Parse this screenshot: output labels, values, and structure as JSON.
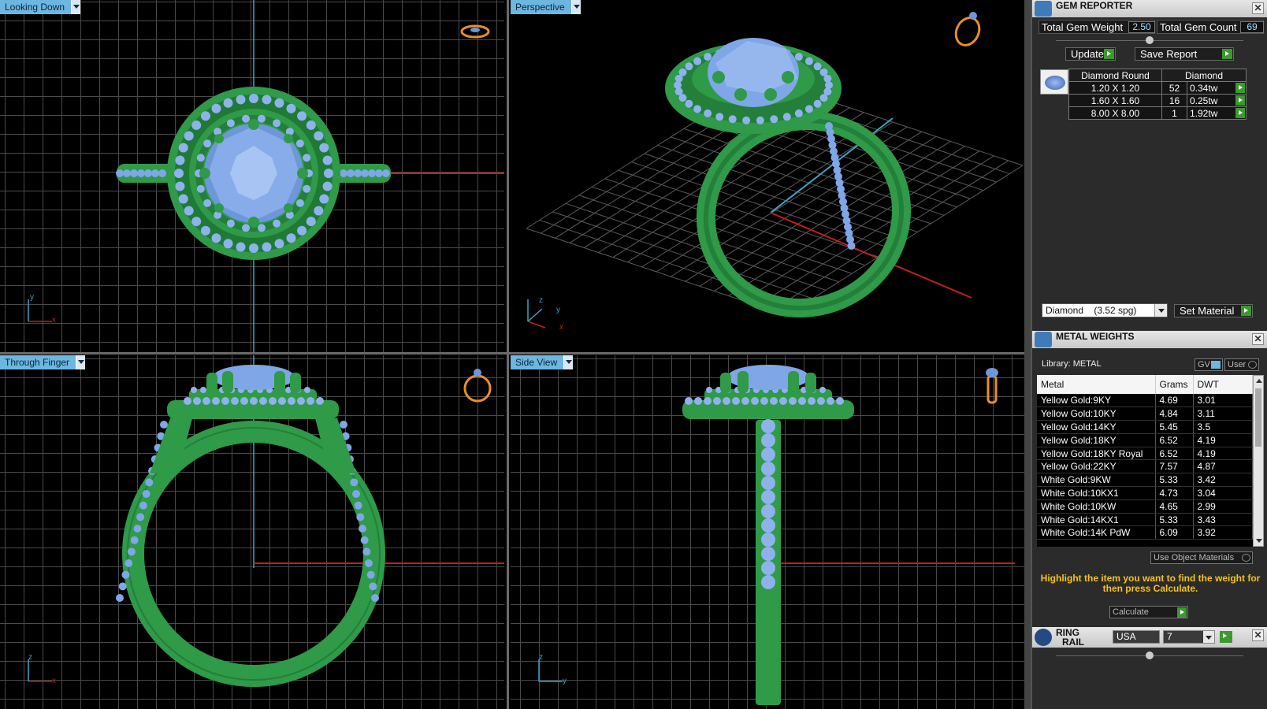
{
  "viewports": [
    {
      "id": "top",
      "label": "Looking Down"
    },
    {
      "id": "persp",
      "label": "Perspective"
    },
    {
      "id": "front",
      "label": "Through Finger"
    },
    {
      "id": "side",
      "label": "Side View"
    }
  ],
  "axes": {
    "top": {
      "a": "y",
      "b": "x"
    },
    "persp": {
      "a": "z",
      "b": "y",
      "c": "x"
    },
    "front": {
      "a": "z",
      "b": "x"
    },
    "side": {
      "a": "z",
      "b": "y"
    }
  },
  "gem_reporter": {
    "title": "GEM REPORTER",
    "total_weight_label": "Total Gem Weight",
    "total_weight_value": "2.50",
    "total_count_label": "Total Gem Count",
    "total_count_value": "69",
    "update_label": "Update",
    "save_label": "Save Report",
    "col_shape": "Diamond Round",
    "col_material": "Diamond",
    "rows": [
      {
        "size": "1.20 X 1.20",
        "count": "52",
        "weight": "0.34tw"
      },
      {
        "size": "1.60 X 1.60",
        "count": "16",
        "weight": "0.25tw"
      },
      {
        "size": "8.00 X 8.00",
        "count": "1",
        "weight": "1.92tw"
      }
    ],
    "material_select": "Diamond    (3.52 spg)",
    "set_material_label": "Set Material"
  },
  "metal_weights": {
    "title": "METAL WEIGHTS",
    "library": "Library: METAL",
    "gv": "GV",
    "user": "User",
    "col_metal": "Metal",
    "col_grams": "Grams",
    "col_dwt": "DWT",
    "rows": [
      {
        "metal": "Yellow Gold:9KY",
        "grams": "4.69",
        "dwt": "3.01"
      },
      {
        "metal": "Yellow Gold:10KY",
        "grams": "4.84",
        "dwt": "3.11"
      },
      {
        "metal": "Yellow Gold:14KY",
        "grams": "5.45",
        "dwt": "3.5"
      },
      {
        "metal": "Yellow Gold:18KY",
        "grams": "6.52",
        "dwt": "4.19"
      },
      {
        "metal": "Yellow Gold:18KY Royal",
        "grams": "6.52",
        "dwt": "4.19"
      },
      {
        "metal": "Yellow Gold:22KY",
        "grams": "7.57",
        "dwt": "4.87"
      },
      {
        "metal": "White Gold:9KW",
        "grams": "5.33",
        "dwt": "3.42"
      },
      {
        "metal": "White Gold:10KX1",
        "grams": "4.73",
        "dwt": "3.04"
      },
      {
        "metal": "White Gold:10KW",
        "grams": "4.65",
        "dwt": "2.99"
      },
      {
        "metal": "White Gold:14KX1",
        "grams": "5.33",
        "dwt": "3.43"
      },
      {
        "metal": "White Gold:14K PdW",
        "grams": "6.09",
        "dwt": "3.92"
      }
    ],
    "use_object_materials": "Use Object Materials",
    "hint": "Highlight the item you want to find the weight for then press Calculate.",
    "calculate_label": "Calculate"
  },
  "ring_rail": {
    "title_line1": "RING",
    "title_line2": "RAIL",
    "country": "USA",
    "size": "7"
  },
  "colors": {
    "metal_green": "#2f9a48",
    "gem_blue": "#7fa6e6",
    "grid": "#4a4a4a",
    "label_bg": "#6db6e0",
    "x_axis": "#c0201c",
    "y_axis": "#3aa6c8",
    "hint_yellow": "#f6c21b"
  }
}
